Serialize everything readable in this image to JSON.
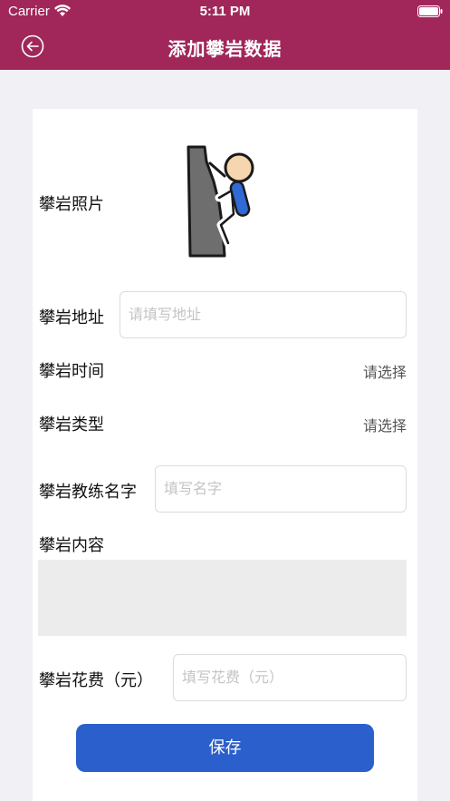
{
  "status_bar": {
    "carrier": "Carrier",
    "time": "5:11 PM"
  },
  "header": {
    "title": "添加攀岩数据",
    "back_icon": "back-arrow-icon"
  },
  "form": {
    "photo_label": "攀岩照片",
    "address_label": "攀岩地址",
    "address_placeholder": "请填写地址",
    "time_label": "攀岩时间",
    "time_value": "请选择",
    "type_label": "攀岩类型",
    "type_value": "请选择",
    "coach_label": "攀岩教练名字",
    "coach_placeholder": "填写名字",
    "content_label": "攀岩内容",
    "cost_label": "攀岩花费（元）",
    "cost_placeholder": "填写花费（元）",
    "save_label": "保存"
  },
  "colors": {
    "header": "#a1275a",
    "button": "#2a5fcc",
    "background": "#f1f1f5"
  }
}
